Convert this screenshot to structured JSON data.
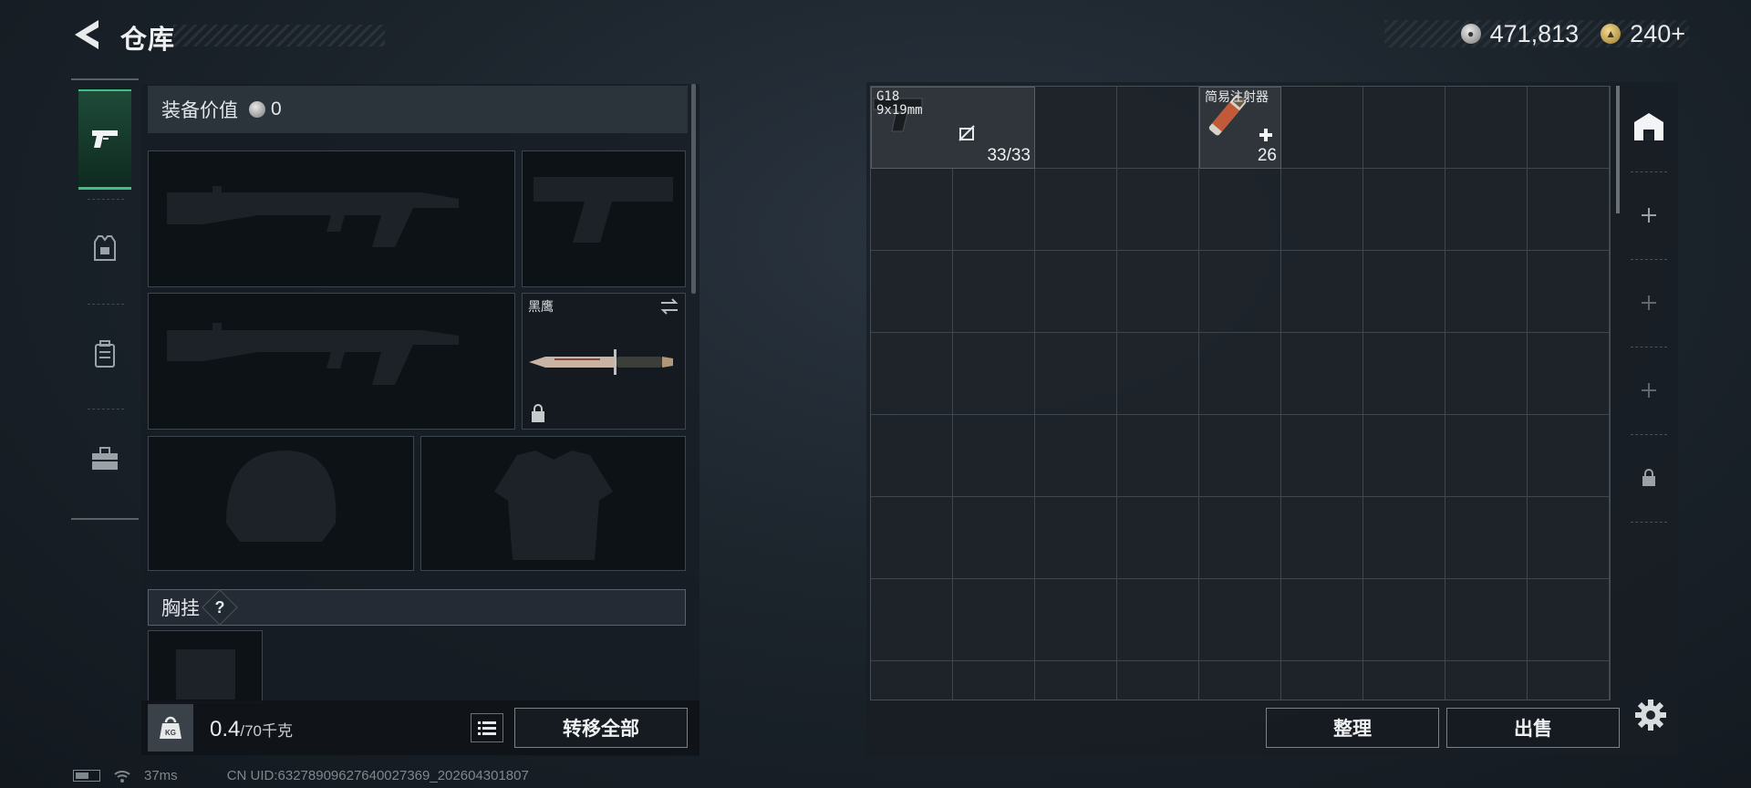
{
  "header": {
    "title": "仓库"
  },
  "currency": {
    "silver_value": "471,813",
    "gold_value": "240+"
  },
  "equipment": {
    "value_label": "装备价值",
    "value_amount": "0",
    "knife_slot_name": "黑鹰",
    "chest_label": "胸挂",
    "help_symbol": "?"
  },
  "weight": {
    "current": "0.4",
    "max_text": "/70千克",
    "icon_text": "KG"
  },
  "buttons": {
    "transfer_all": "转移全部",
    "sort": "整理",
    "sell": "出售"
  },
  "storage": {
    "items": [
      {
        "name_line1": "G18",
        "name_line2": "9x19mm",
        "count": "33/33"
      },
      {
        "name_line1": "简易注射器",
        "name_line2": "",
        "count": "26"
      }
    ]
  },
  "status": {
    "ping": "37ms",
    "uid": "CN UID:63278909627640027369_202604301807"
  },
  "colors": {
    "accent_green": "#3fbf83",
    "panel_bg": "#1c242c"
  }
}
